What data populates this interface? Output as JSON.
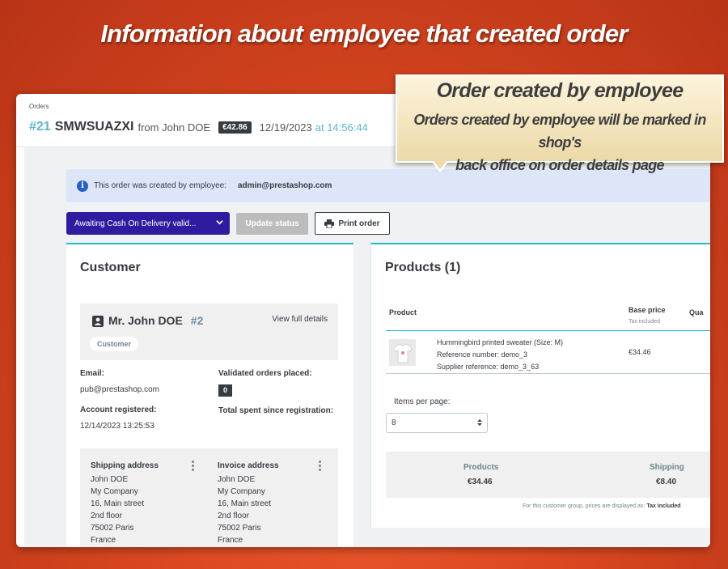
{
  "headline": "Information about employee that created order",
  "callout": {
    "title": "Order created by employee",
    "body_line1": "Orders created by employee will be marked in shop's",
    "body_line2": "back office on order details page"
  },
  "header": {
    "breadcrumb": "Orders",
    "order_number": "#21",
    "order_reference": "SMWSUAZXI",
    "from_text": "from John DOE",
    "total_badge": "€42.86",
    "date": "12/19/2023",
    "time_text": "at 14:56:44"
  },
  "alert": {
    "icon": "info-icon",
    "text": "This order was created by employee:",
    "email": "admin@prestashop.com",
    "color": "#dde6f8"
  },
  "actions": {
    "status_value": "Awaiting Cash On Delivery valid...",
    "status_color": "#2d1ca0",
    "update_label": "Update status",
    "print_label": "Print order"
  },
  "customer": {
    "title": "Customer",
    "name": "Mr. John DOE",
    "id": "#2",
    "view_full": "View full details",
    "badge": "Customer",
    "email_label": "Email:",
    "email_value": "pub@prestashop.com",
    "validated_label": "Validated orders placed:",
    "validated_value": "0",
    "registered_label": "Account registered:",
    "registered_value": "12/14/2023 13:25:53",
    "total_spent_label": "Total spent since registration:",
    "shipping": {
      "heading": "Shipping address",
      "lines": [
        "John DOE",
        "My Company",
        "16, Main street",
        "2nd floor",
        "75002 Paris",
        "France"
      ]
    },
    "invoice": {
      "heading": "Invoice address",
      "lines": [
        "John DOE",
        "My Company",
        "16, Main street",
        "2nd floor",
        "75002 Paris",
        "France"
      ]
    }
  },
  "products": {
    "title": "Products (1)",
    "col_product": "Product",
    "col_base_price": "Base price",
    "col_base_price_sub": "Tax included",
    "col_quantity": "Qua",
    "item": {
      "name": "Hummingbird printed sweater (Size: M)",
      "reference": "Reference number: demo_3",
      "supplier": "Supplier reference: demo_3_63",
      "price": "€34.46"
    },
    "items_per_page_label": "Items per page:",
    "items_per_page_value": "8",
    "totals": {
      "products_label": "Products",
      "products_value": "€34.46",
      "shipping_label": "Shipping",
      "shipping_value": "€8.40"
    },
    "tax_note": "For this customer group, prices are displayed as:",
    "tax_note_bold": "Tax included"
  },
  "colors": {
    "accent": "#25b9d7",
    "order_number": "#5fb4cf",
    "background": "#d64620"
  }
}
